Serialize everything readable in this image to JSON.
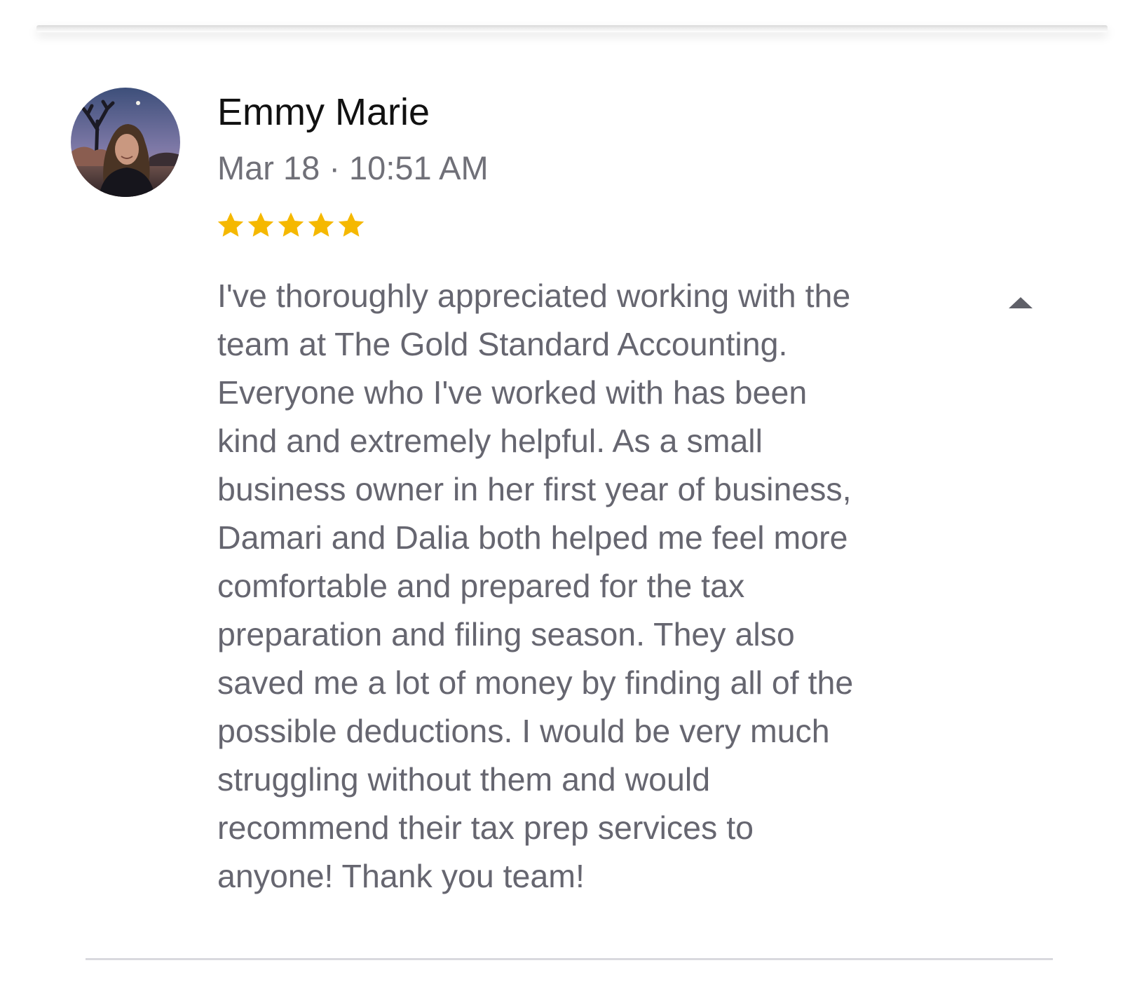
{
  "review": {
    "reviewer_name": "Emmy Marie",
    "timestamp": "Mar 18 · 10:51 AM",
    "rating": 5,
    "rating_max": 5,
    "text": "I've thoroughly appreciated working with the\nteam at The Gold Standard Accounting.\nEveryone who I've worked with has been\nkind and extremely helpful. As a small\nbusiness owner in her first year of business,\nDamari and Dalia both helped me feel more\ncomfortable and prepared for the tax\npreparation and filing season. They also\nsaved me a lot of money by finding all of the\npossible deductions. I would be very much\nstruggling without them and would\nrecommend their tax prep services to\nanyone! Thank you team!",
    "expanded": true
  },
  "icons": {
    "avatar": "user-photo-avatar",
    "star": "star-icon",
    "collapse": "caret-up-icon"
  },
  "colors": {
    "star": "#F5B800",
    "name": "#111111",
    "secondary_text": "#707078",
    "body_text": "#666670",
    "divider": "#D9D9DE",
    "caret": "#5F6068"
  }
}
